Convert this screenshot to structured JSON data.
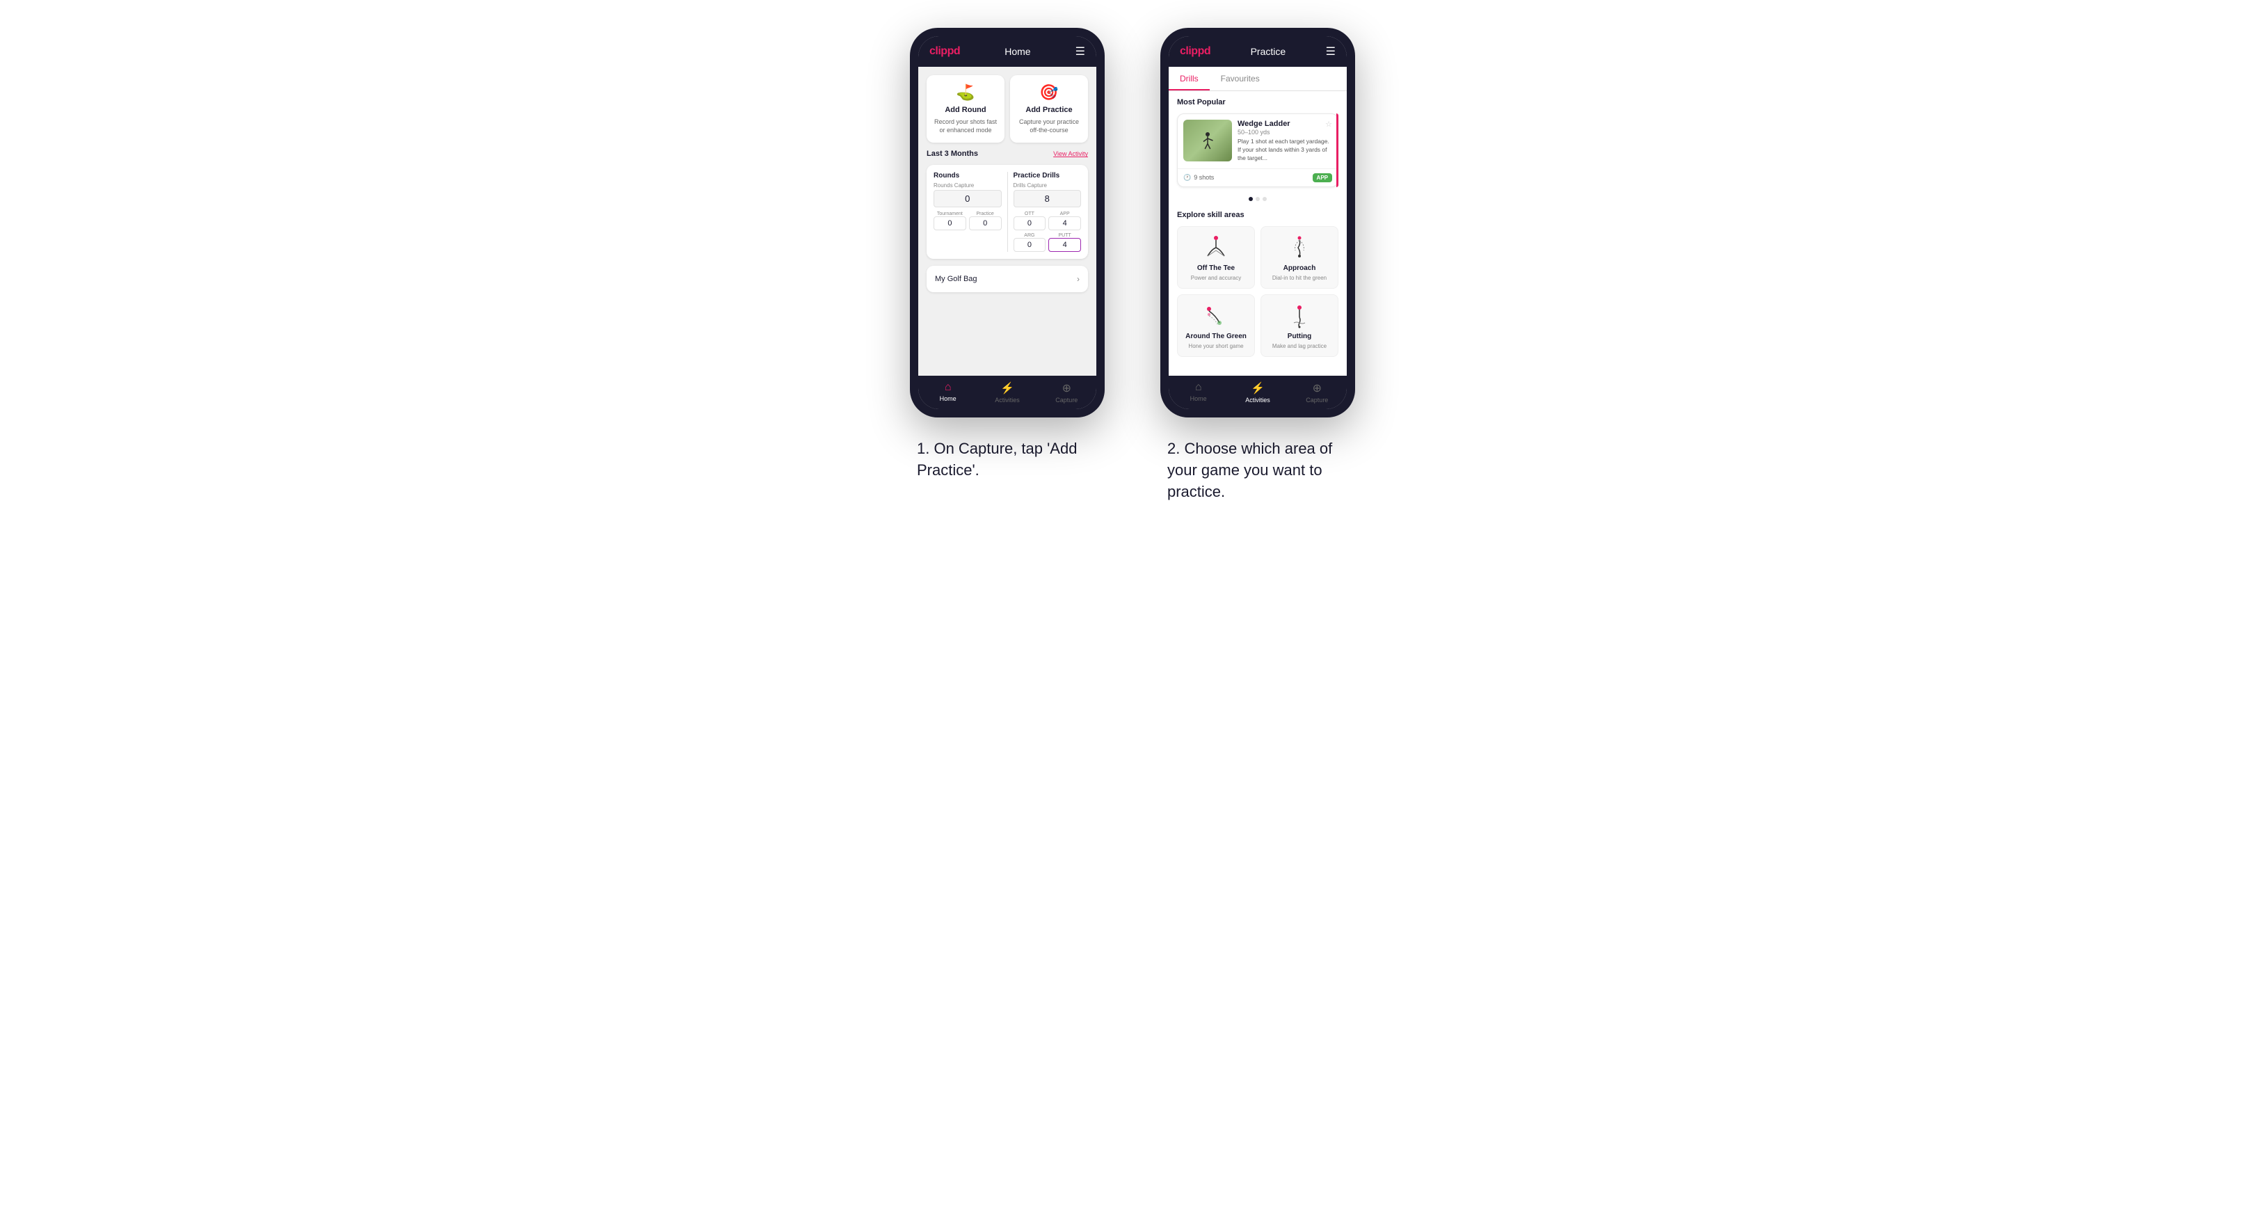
{
  "phone1": {
    "header": {
      "logo": "clippd",
      "title": "Home",
      "menu_icon": "☰"
    },
    "action_cards": [
      {
        "id": "add-round",
        "title": "Add Round",
        "subtitle": "Record your shots fast or enhanced mode",
        "icon": "⛳"
      },
      {
        "id": "add-practice",
        "title": "Add Practice",
        "subtitle": "Capture your practice off-the-course",
        "icon": "🎯"
      }
    ],
    "stats_section": {
      "label": "Last 3 Months",
      "view_activity": "View Activity",
      "rounds": {
        "title": "Rounds",
        "capture_label": "Rounds Capture",
        "capture_value": "0",
        "tournament_label": "Tournament",
        "tournament_value": "0",
        "practice_label": "Practice",
        "practice_value": "0"
      },
      "practice_drills": {
        "title": "Practice Drills",
        "capture_label": "Drills Capture",
        "capture_value": "8",
        "ott_label": "OTT",
        "ott_value": "0",
        "app_label": "APP",
        "app_value": "4",
        "arg_label": "ARG",
        "arg_value": "0",
        "putt_label": "PUTT",
        "putt_value": "4"
      }
    },
    "golf_bag": {
      "label": "My Golf Bag"
    },
    "bottom_nav": [
      {
        "id": "home",
        "label": "Home",
        "icon": "⌂",
        "active": true
      },
      {
        "id": "activities",
        "label": "Activities",
        "icon": "⚡",
        "active": false
      },
      {
        "id": "capture",
        "label": "Capture",
        "icon": "⊕",
        "active": false
      }
    ]
  },
  "phone2": {
    "header": {
      "logo": "clippd",
      "title": "Practice",
      "menu_icon": "☰"
    },
    "tabs": [
      {
        "id": "drills",
        "label": "Drills",
        "active": true
      },
      {
        "id": "favourites",
        "label": "Favourites",
        "active": false
      }
    ],
    "most_popular": {
      "section_title": "Most Popular",
      "featured_drill": {
        "title": "Wedge Ladder",
        "yardage": "50–100 yds",
        "description": "Play 1 shot at each target yardage. If your shot lands within 3 yards of the target...",
        "shots": "9 shots",
        "badge": "APP"
      },
      "dots": [
        {
          "active": true
        },
        {
          "active": false
        },
        {
          "active": false
        }
      ]
    },
    "explore": {
      "section_title": "Explore skill areas",
      "skills": [
        {
          "id": "off-the-tee",
          "name": "Off The Tee",
          "desc": "Power and accuracy",
          "icon_type": "tee"
        },
        {
          "id": "approach",
          "name": "Approach",
          "desc": "Dial-in to hit the green",
          "icon_type": "approach"
        },
        {
          "id": "around-the-green",
          "name": "Around The Green",
          "desc": "Hone your short game",
          "icon_type": "arg"
        },
        {
          "id": "putting",
          "name": "Putting",
          "desc": "Make and lag practice",
          "icon_type": "putting"
        }
      ]
    },
    "bottom_nav": [
      {
        "id": "home",
        "label": "Home",
        "icon": "⌂",
        "active": false
      },
      {
        "id": "activities",
        "label": "Activities",
        "icon": "⚡",
        "active": true
      },
      {
        "id": "capture",
        "label": "Capture",
        "icon": "⊕",
        "active": false
      }
    ]
  },
  "captions": {
    "caption1": "1. On Capture, tap 'Add Practice'.",
    "caption2": "2. Choose which area of your game you want to practice."
  }
}
